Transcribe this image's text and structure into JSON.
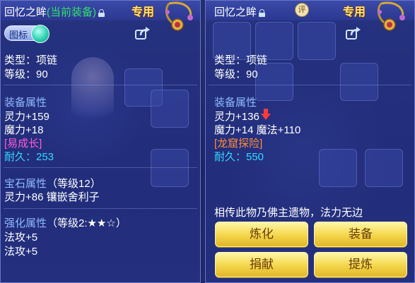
{
  "left": {
    "title": "回忆之眸",
    "current_tag": "(当前装备)",
    "special_label": "专用",
    "icon_toggle_label": "图标",
    "type_line": "类型：项链",
    "level_line": "等级：90",
    "equip_attr_header": "装备属性",
    "attr1": "灵力+159",
    "attr2": "魔力+18",
    "tag": "[易成长]",
    "durability": "耐久：253",
    "gem_header": "宝石属性",
    "gem_level": "（等级12）",
    "gem_line": "灵力+86 镶嵌舍利子",
    "enhance_header": "强化属性",
    "enhance_level": "（等级2:★★☆）",
    "enhance1": "法攻+5",
    "enhance2": "法攻+5"
  },
  "right": {
    "title": "回忆之眸",
    "tag_icon_text": "评",
    "special_label": "专用",
    "type_line": "类型：项链",
    "level_line": "等级：90",
    "equip_attr_header": "装备属性",
    "attr1": "灵力+136",
    "attr2": "魔力+14 魔法+110",
    "tag": "[龙窟探险]",
    "durability": "耐久：550",
    "description": "相传此物乃佛主遗物，法力无边",
    "buttons": {
      "refine": "炼化",
      "equip": "装备",
      "donate": "捐献",
      "extract": "提炼"
    }
  },
  "colors": {
    "current_equipped": "#33e06b",
    "attr_header": "#8fb8ff",
    "durability": "#35d7ff",
    "tag_left": "#ff5bd6",
    "tag_right": "#ff8a3a",
    "button_text": "#6a3a06"
  }
}
